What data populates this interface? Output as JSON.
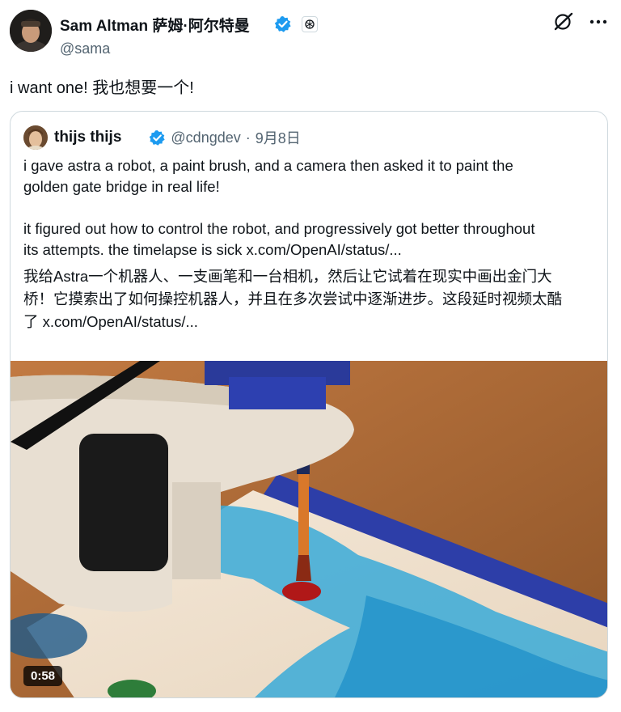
{
  "post": {
    "author_name": "Sam Altman 萨姆·阿尔特曼",
    "handle": "@sama",
    "text": "i want one! 我也想要一个!",
    "icons": {
      "verified": "verified-badge-icon",
      "affiliate": "openai-affiliate-icon",
      "grok": "grok-icon",
      "more": "more-icon"
    }
  },
  "quote": {
    "author_name": "thijs thijs",
    "handle": "@cdngdev",
    "separator": "·",
    "date": "9月8日",
    "lines": [
      "i gave astra a robot, a paint brush, and a camera then asked it to paint the",
      "golden gate bridge in real life!",
      "",
      "it figured out how to control the robot, and progressively got better throughout",
      "its attempts. the timelapse is sick  x.com/OpenAI/status/..."
    ],
    "translation_lines": [
      "我给Astra一个机器人、一支画笔和一台相机，然后让它试着在现实中画出金门大",
      "桥！它摸索出了如何操控机器人，并且在多次尝试中逐渐进步。这段延时视频太酷",
      "了  x.com/OpenAI/status/..."
    ]
  },
  "media": {
    "type": "video",
    "duration": "0:58"
  },
  "colors": {
    "text": "#0f1419",
    "secondary": "#536471",
    "verified_blue": "#1d9bf0",
    "border": "#cfd9de"
  }
}
